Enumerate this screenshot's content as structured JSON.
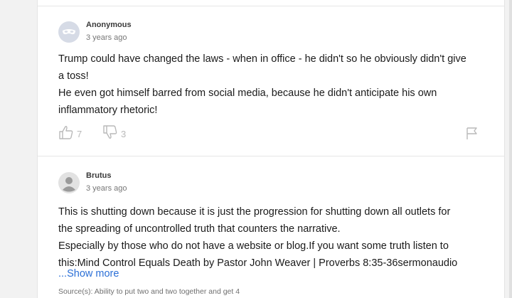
{
  "comments": [
    {
      "author": "Anonymous",
      "time": "3 years ago",
      "avatar_icon": "masked-face-icon",
      "lines": [
        "Trump could have changed the laws - when in office - he didn't so he obviously didn't give",
        "a toss!",
        "He even got himself barred from social media, because he didn't anticipate his own",
        "inflammatory rhetoric!"
      ],
      "upvotes": "7",
      "downvotes": "3"
    },
    {
      "author": "Brutus",
      "time": "3 years ago",
      "avatar_icon": "default-user-icon",
      "lines": [
        "This is shutting down because it is just the progression for shutting down all outlets for",
        "the spreading of uncontrolled truth that counters the narrative.",
        "Especially by those who do not have a website or blog.If you want some truth listen to",
        "this:Mind Control Equals Death by Pastor John Weaver | Proverbs 8:35-36sermonaudio"
      ],
      "show_more": "...Show more",
      "source": "Source(s): Ability to put two and two together and get 4"
    }
  ],
  "colors": {
    "link": "#2b6fd6",
    "icon": "#b9b9b9"
  }
}
